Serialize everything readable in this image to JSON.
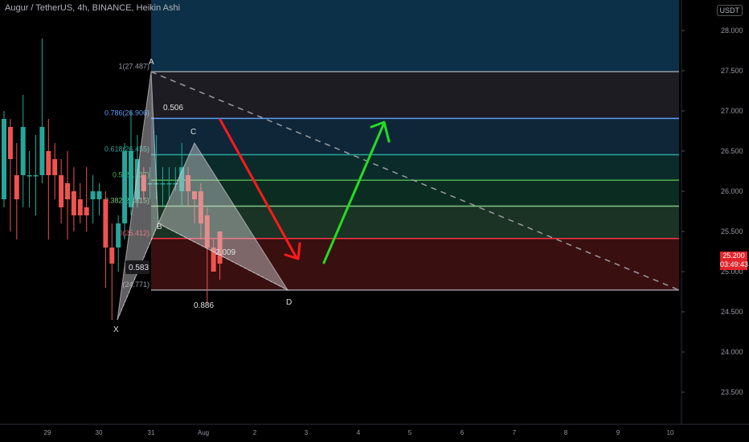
{
  "header": {
    "title": "Augur / TetherUS, 4h, BINANCE, Heikin Ashi",
    "currency_button": "USDT"
  },
  "price_axis": {
    "ticks": [
      "28.000",
      "27.500",
      "27.000",
      "26.500",
      "26.000",
      "25.500",
      "25.000",
      "24.500",
      "24.000",
      "23.500"
    ]
  },
  "time_axis": {
    "ticks": [
      "29",
      "30",
      "31",
      "Aug",
      "2",
      "3",
      "4",
      "5",
      "6",
      "7",
      "8",
      "9",
      "10"
    ]
  },
  "last_price": {
    "price": "25.200",
    "countdown": "03:49:43"
  },
  "fib": {
    "levels": [
      {
        "label": "1(27.487)",
        "color": "#9598a1"
      },
      {
        "label": "0.786(26.906)",
        "color": "#5b9cf6"
      },
      {
        "label": "0.618(26.455)",
        "color": "#26a69a"
      },
      {
        "label": "0.5(26.137)",
        "color": "#4caf50"
      },
      {
        "label": "0.382(25.815)",
        "color": "#81c784"
      },
      {
        "label": "0(25.412)",
        "color": "#f23645"
      },
      {
        "label": "(24.771)",
        "color": "#9598a1"
      }
    ]
  },
  "pattern": {
    "points": {
      "A": "A",
      "B": "B",
      "C": "C",
      "D": "D",
      "X": "X"
    },
    "ratios": {
      "ab": "0.583",
      "bc": "0.886",
      "xa": "0.506",
      "cd": "2.009"
    }
  },
  "colors": {
    "bull": "#26a69a",
    "bear": "#ef5350",
    "down_arrow": "#ff1a1a",
    "up_arrow": "#22dd22"
  },
  "chart_data": {
    "type": "candlestick",
    "symbol": "Augur / TetherUS",
    "interval": "4h",
    "exchange": "BINANCE",
    "style": "Heikin Ashi",
    "ylim": [
      23.3,
      28.4
    ],
    "fib_levels": [
      27.487,
      26.906,
      26.455,
      26.137,
      25.815,
      25.412,
      24.771
    ],
    "harmonic_points": {
      "X": 24.4,
      "A": 27.487,
      "B": 25.6,
      "C": 26.6,
      "D": 24.771
    },
    "candles": [
      {
        "o": 25.9,
        "c": 26.9,
        "h": 27.0,
        "l": 25.8
      },
      {
        "o": 26.8,
        "c": 26.4,
        "h": 26.9,
        "l": 25.5
      },
      {
        "o": 26.2,
        "c": 25.9,
        "h": 26.6,
        "l": 25.4
      },
      {
        "o": 26.2,
        "c": 26.8,
        "h": 27.2,
        "l": 25.8
      },
      {
        "o": 26.2,
        "c": 26.2,
        "h": 26.5,
        "l": 25.8
      },
      {
        "o": 26.2,
        "c": 26.2,
        "h": 26.7,
        "l": 25.7
      },
      {
        "o": 26.2,
        "c": 26.8,
        "h": 27.9,
        "l": 26.1
      },
      {
        "o": 26.5,
        "c": 26.2,
        "h": 26.9,
        "l": 25.4
      },
      {
        "o": 26.4,
        "c": 26.2,
        "h": 26.6,
        "l": 25.9
      },
      {
        "o": 26.2,
        "c": 25.8,
        "h": 26.4,
        "l": 25.6
      },
      {
        "o": 26.1,
        "c": 25.9,
        "h": 26.5,
        "l": 25.4
      },
      {
        "o": 26.0,
        "c": 25.7,
        "h": 26.3,
        "l": 25.5
      },
      {
        "o": 25.9,
        "c": 25.7,
        "h": 26.1,
        "l": 25.6
      },
      {
        "o": 25.8,
        "c": 25.7,
        "h": 26.3,
        "l": 25.5
      },
      {
        "o": 25.9,
        "c": 26.0,
        "h": 26.2,
        "l": 25.6
      },
      {
        "o": 25.9,
        "c": 26.0,
        "h": 26.1,
        "l": 25.7
      },
      {
        "o": 25.9,
        "c": 25.3,
        "h": 26.0,
        "l": 24.8
      },
      {
        "o": 25.3,
        "c": 25.1,
        "h": 25.6,
        "l": 24.4
      },
      {
        "o": 25.3,
        "c": 25.6,
        "h": 25.7,
        "l": 25.0
      },
      {
        "o": 25.6,
        "c": 26.5,
        "h": 26.6,
        "l": 25.4
      },
      {
        "o": 25.8,
        "c": 26.5,
        "h": 27.0,
        "l": 25.7
      },
      {
        "o": 25.9,
        "c": 26.4,
        "h": 26.7,
        "l": 25.8
      },
      {
        "o": 26.2,
        "c": 26.0,
        "h": 26.3,
        "l": 25.9
      },
      {
        "o": 26.1,
        "c": 26.1,
        "h": 26.3,
        "l": 25.9
      },
      {
        "o": 26.1,
        "c": 26.1,
        "h": 26.7,
        "l": 25.9
      },
      {
        "o": 26.1,
        "c": 26.1,
        "h": 26.3,
        "l": 25.8
      },
      {
        "o": 26.1,
        "c": 26.1,
        "h": 26.3,
        "l": 25.9
      },
      {
        "o": 26.1,
        "c": 26.1,
        "h": 26.3,
        "l": 26.0
      },
      {
        "o": 26.0,
        "c": 26.3,
        "h": 26.6,
        "l": 25.8
      },
      {
        "o": 26.2,
        "c": 26.0,
        "h": 26.3,
        "l": 25.8
      },
      {
        "o": 26.0,
        "c": 25.9,
        "h": 26.0,
        "l": 25.6
      },
      {
        "o": 26.0,
        "c": 25.6,
        "h": 26.1,
        "l": 25.4
      },
      {
        "o": 25.7,
        "c": 25.3,
        "h": 25.8,
        "l": 24.6
      },
      {
        "o": 25.3,
        "c": 25.0,
        "h": 25.4,
        "l": 25.0
      },
      {
        "o": 25.5,
        "c": 25.1,
        "h": 25.5,
        "l": 24.9
      }
    ]
  }
}
